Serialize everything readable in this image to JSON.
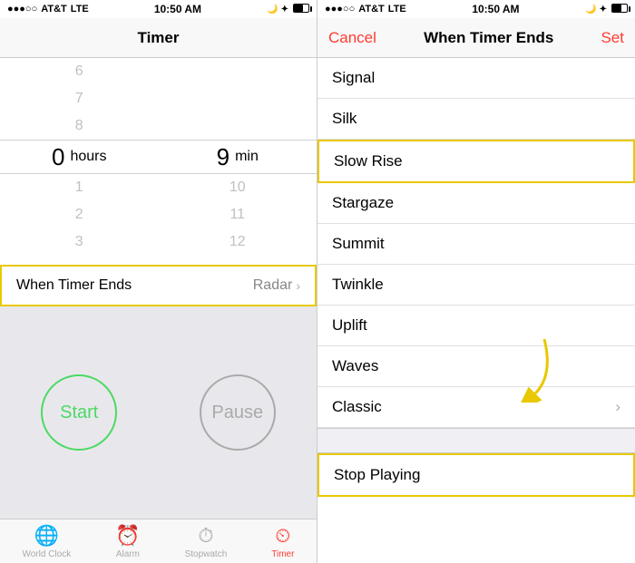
{
  "left": {
    "statusBar": {
      "carrier": "AT&T",
      "network": "LTE",
      "time": "10:50 AM",
      "icons": "🌙 ↑ ✦ ▶"
    },
    "navTitle": "Timer",
    "picker": {
      "hoursAbove": [
        "6",
        "7",
        "8"
      ],
      "hoursSelected": "0",
      "hoursLabel": "hours",
      "hoursBelow": [
        "1",
        "2",
        "3"
      ],
      "minAbove": [
        "",
        "",
        ""
      ],
      "minSelected": "9",
      "minLabel": "min",
      "minBelow": [
        "10",
        "11",
        "12"
      ]
    },
    "whenTimerEnds": {
      "label": "When Timer Ends",
      "value": "Radar"
    },
    "buttons": {
      "start": "Start",
      "pause": "Pause"
    },
    "tabs": [
      {
        "name": "world-clock-tab",
        "icon": "🌐",
        "label": "World Clock",
        "active": false
      },
      {
        "name": "alarm-tab",
        "icon": "⏰",
        "label": "Alarm",
        "active": false
      },
      {
        "name": "stopwatch-tab",
        "icon": "⏱",
        "label": "Stopwatch",
        "active": false
      },
      {
        "name": "timer-tab",
        "icon": "⏲",
        "label": "Timer",
        "active": true
      }
    ]
  },
  "right": {
    "statusBar": {
      "carrier": "AT&T",
      "network": "LTE",
      "time": "10:50 AM"
    },
    "nav": {
      "cancel": "Cancel",
      "title": "When Timer Ends",
      "set": "Set"
    },
    "items": [
      {
        "label": "Signal",
        "hasChevron": false
      },
      {
        "label": "Silk",
        "hasChevron": false
      },
      {
        "label": "Slow Rise",
        "hasChevron": false,
        "highlighted": true
      },
      {
        "label": "Stargaze",
        "hasChevron": false
      },
      {
        "label": "Summit",
        "hasChevron": false
      },
      {
        "label": "Twinkle",
        "hasChevron": false
      },
      {
        "label": "Uplift",
        "hasChevron": false
      },
      {
        "label": "Waves",
        "hasChevron": false
      },
      {
        "label": "Classic",
        "hasChevron": true
      }
    ],
    "stopPlaying": "Stop Playing"
  }
}
